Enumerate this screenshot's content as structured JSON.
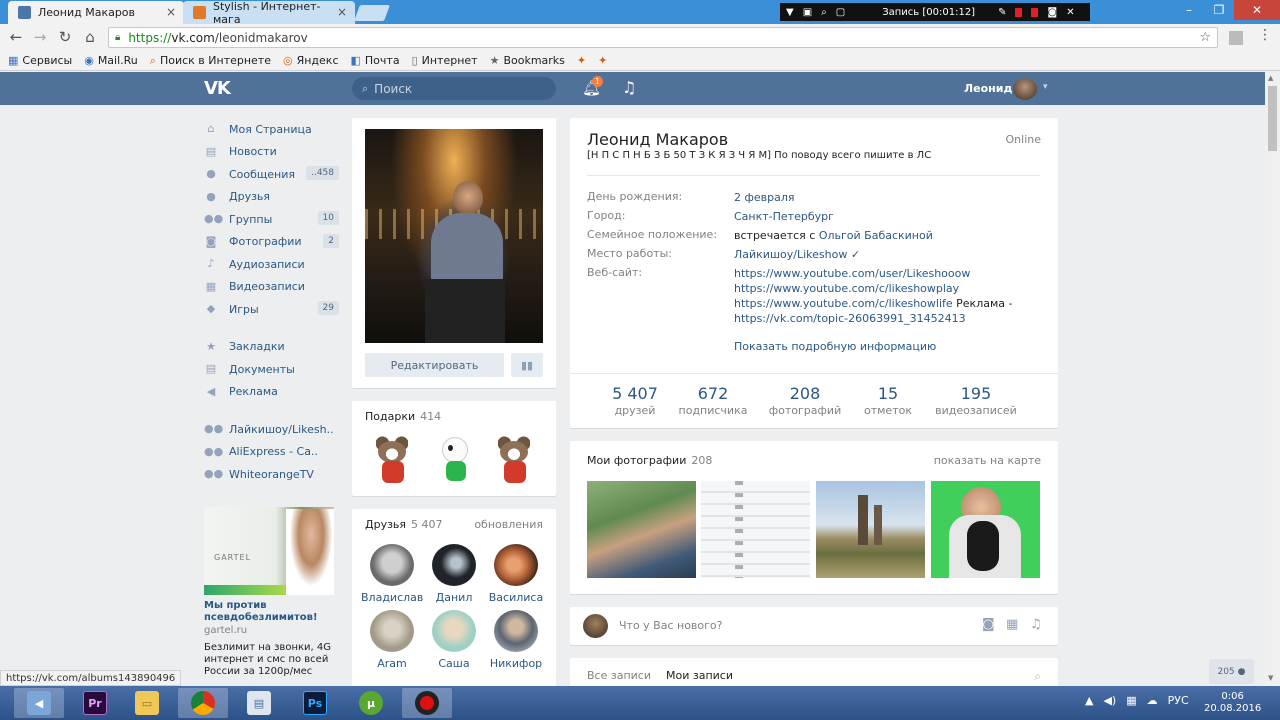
{
  "browser": {
    "tabs": [
      {
        "title": "Леонид Макаров"
      },
      {
        "title": "Stylish - Интернет-мага"
      }
    ],
    "url_scheme": "https://",
    "url_host": "vk.com",
    "url_path": "/leonidmakarov",
    "bookmarks": [
      "Сервисы",
      "Mail.Ru",
      "Поиск в Интернете",
      "Яндекс",
      "Почта",
      "Интернет",
      "Bookmarks"
    ],
    "status_url": "https://vk.com/albums143890496"
  },
  "recorder": {
    "label": "Запись [00:01:12]"
  },
  "header": {
    "logo": "VK",
    "search_placeholder": "Поиск",
    "notifications_count": "1",
    "user_name": "Леонид"
  },
  "left_menu": {
    "items": [
      {
        "label": "Моя Страница",
        "badge": ""
      },
      {
        "label": "Новости",
        "badge": ""
      },
      {
        "label": "Сообщения",
        "badge": "..458"
      },
      {
        "label": "Друзья",
        "badge": ""
      },
      {
        "label": "Группы",
        "badge": "10"
      },
      {
        "label": "Фотографии",
        "badge": "2"
      },
      {
        "label": "Аудиозаписи",
        "badge": ""
      },
      {
        "label": "Видеозаписи",
        "badge": ""
      },
      {
        "label": "Игры",
        "badge": "29"
      }
    ],
    "extra": [
      "Закладки",
      "Документы",
      "Реклама"
    ],
    "groups": [
      "Лайкишоу/Likesh..",
      "AliExpress - Ca..",
      "WhiteorangeTV"
    ]
  },
  "ad": {
    "logo": "GARTEL",
    "title": "Мы против псевдобезлимитов!",
    "domain": "gartel.ru",
    "text": "Безлимит на звонки, 4G интернет и смс по всей России за 1200р/мес"
  },
  "profile": {
    "edit_label": "Редактировать",
    "name": "Леонид Макаров",
    "online": "Online",
    "status": "[Н П С П Н Б З Б 50 Т З К Я З Ч Я М] По поводу всего пишите в ЛС",
    "info": {
      "birthday_label": "День рождения:",
      "birthday": "2 февраля",
      "city_label": "Город:",
      "city": "Санкт-Петербург",
      "family_label": "Семейное положение:",
      "family_text": "встречается с",
      "family_link": "Ольгой Бабаскиной",
      "work_label": "Место работы:",
      "work": "Лайкишоу/Likeshow ✓",
      "site_label": "Веб-сайт:",
      "site1": "https://www.youtube.com/user/Likeshooow",
      "site2": "https://www.youtube.com/c/likeshowplay",
      "site3": "https://www.youtube.com/c/likeshowlife",
      "site3_suffix": " Реклама -",
      "site4": "https://vk.com/topic-26063991_31452413"
    },
    "more_info": "Показать подробную информацию",
    "counters": [
      {
        "num": "5 407",
        "label": "друзей"
      },
      {
        "num": "672",
        "label": "подписчика"
      },
      {
        "num": "208",
        "label": "фотографий"
      },
      {
        "num": "15",
        "label": "отметок"
      },
      {
        "num": "195",
        "label": "видеозаписей"
      }
    ]
  },
  "gifts": {
    "title": "Подарки",
    "count": "414"
  },
  "friends": {
    "title": "Друзья",
    "count": "5 407",
    "updates": "обновления",
    "list": [
      {
        "name": "Владислав",
        "color": "#6b6b6b"
      },
      {
        "name": "Данил",
        "color": "#20242a"
      },
      {
        "name": "Василиса",
        "color": "#b4623a"
      },
      {
        "name": "Aram",
        "color": "#a39a88"
      },
      {
        "name": "Саша",
        "color": "#9ed0c6"
      },
      {
        "name": "Никифор",
        "color": "#5c6470"
      }
    ]
  },
  "photos": {
    "title": "Мои фотографии",
    "count": "208",
    "map_link": "показать на карте"
  },
  "post": {
    "placeholder": "Что у Вас нового?"
  },
  "wall": {
    "tab_all": "Все записи",
    "tab_mine": "Мои записи"
  },
  "online_friends": "205",
  "taskbar": {
    "tray_lang": "РУС",
    "time": "0:06",
    "date": "20.08.2016"
  }
}
